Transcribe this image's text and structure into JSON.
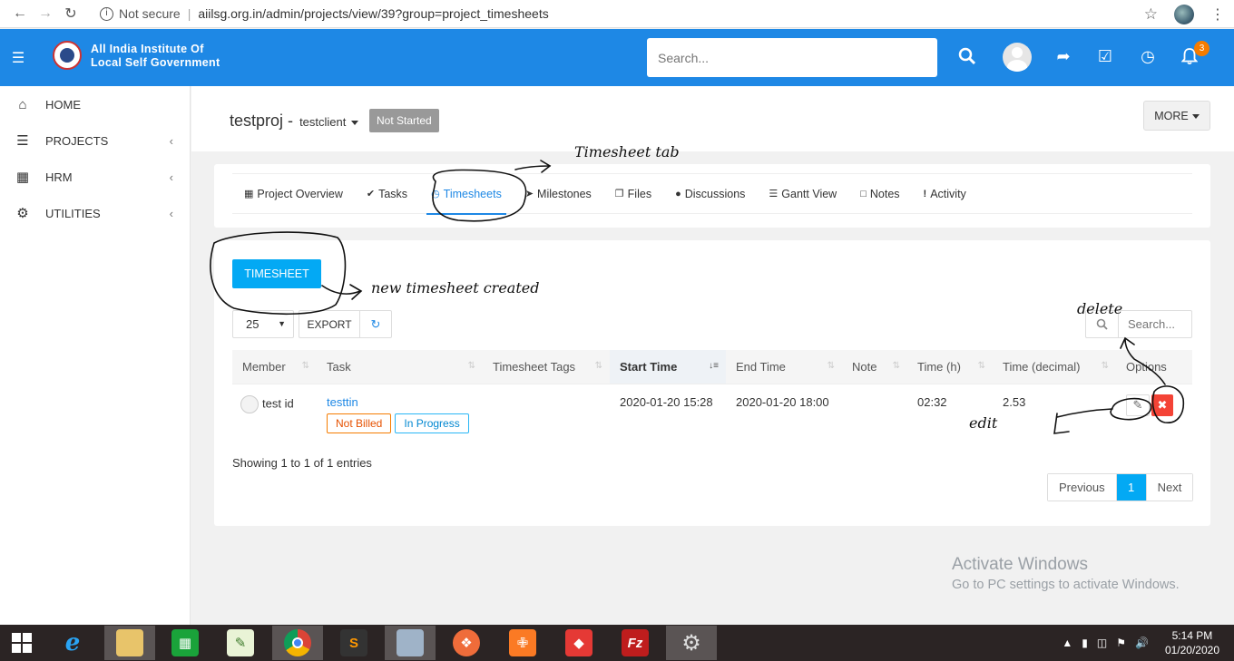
{
  "browser": {
    "security": "Not secure",
    "url": "aiilsg.org.in/admin/projects/view/39?group=project_timesheets"
  },
  "header": {
    "org_line1": "All India Institute Of",
    "org_line2": "Local Self Government",
    "search_placeholder": "Search...",
    "notification_count": "3"
  },
  "sidebar": {
    "items": [
      {
        "label": "HOME",
        "icon": "home-icon"
      },
      {
        "label": "PROJECTS",
        "icon": "bars-icon"
      },
      {
        "label": "HRM",
        "icon": "calculator-icon"
      },
      {
        "label": "UTILITIES",
        "icon": "cogs-icon"
      }
    ]
  },
  "project": {
    "name": "testproj",
    "separator": "-",
    "client": "testclient",
    "status": "Not Started",
    "more_label": "MORE"
  },
  "tabs": [
    {
      "label": "Project Overview"
    },
    {
      "label": "Tasks"
    },
    {
      "label": "Timesheets"
    },
    {
      "label": "Milestones"
    },
    {
      "label": "Files"
    },
    {
      "label": "Discussions"
    },
    {
      "label": "Gantt View"
    },
    {
      "label": "Notes"
    },
    {
      "label": "Activity"
    }
  ],
  "toolbar": {
    "timesheet_button": "TIMESHEET",
    "page_length": "25",
    "export_label": "EXPORT",
    "search_placeholder": "Search..."
  },
  "table": {
    "columns": [
      "Member",
      "Task",
      "Timesheet Tags",
      "Start Time",
      "End Time",
      "Note",
      "Time (h)",
      "Time (decimal)",
      "Options"
    ],
    "rows": [
      {
        "member": "test id",
        "task": "testtin",
        "tag1": "Not Billed",
        "tag2": "In Progress",
        "timesheet_tags": "",
        "start": "2020-01-20 15:28",
        "end": "2020-01-20 18:00",
        "note": "",
        "time_h": "02:32",
        "time_decimal": "2.53"
      }
    ]
  },
  "footer": {
    "info": "Showing 1 to 1 of 1 entries",
    "prev": "Previous",
    "page": "1",
    "next": "Next"
  },
  "annotations": {
    "timesheet_tab": "Timesheet tab",
    "new_timesheet": "new timesheet created",
    "delete": "delete",
    "edit": "edit"
  },
  "watermark": {
    "line1": "Activate Windows",
    "line2": "Go to PC settings to activate Windows."
  },
  "taskbar": {
    "time": "5:14 PM",
    "date": "01/20/2020"
  },
  "colors": {
    "header_blue": "#1e88e5",
    "accent_cyan": "#03a9f4",
    "danger": "#f44336",
    "badge_orange": "#f57c00",
    "status_grey": "#999999"
  }
}
